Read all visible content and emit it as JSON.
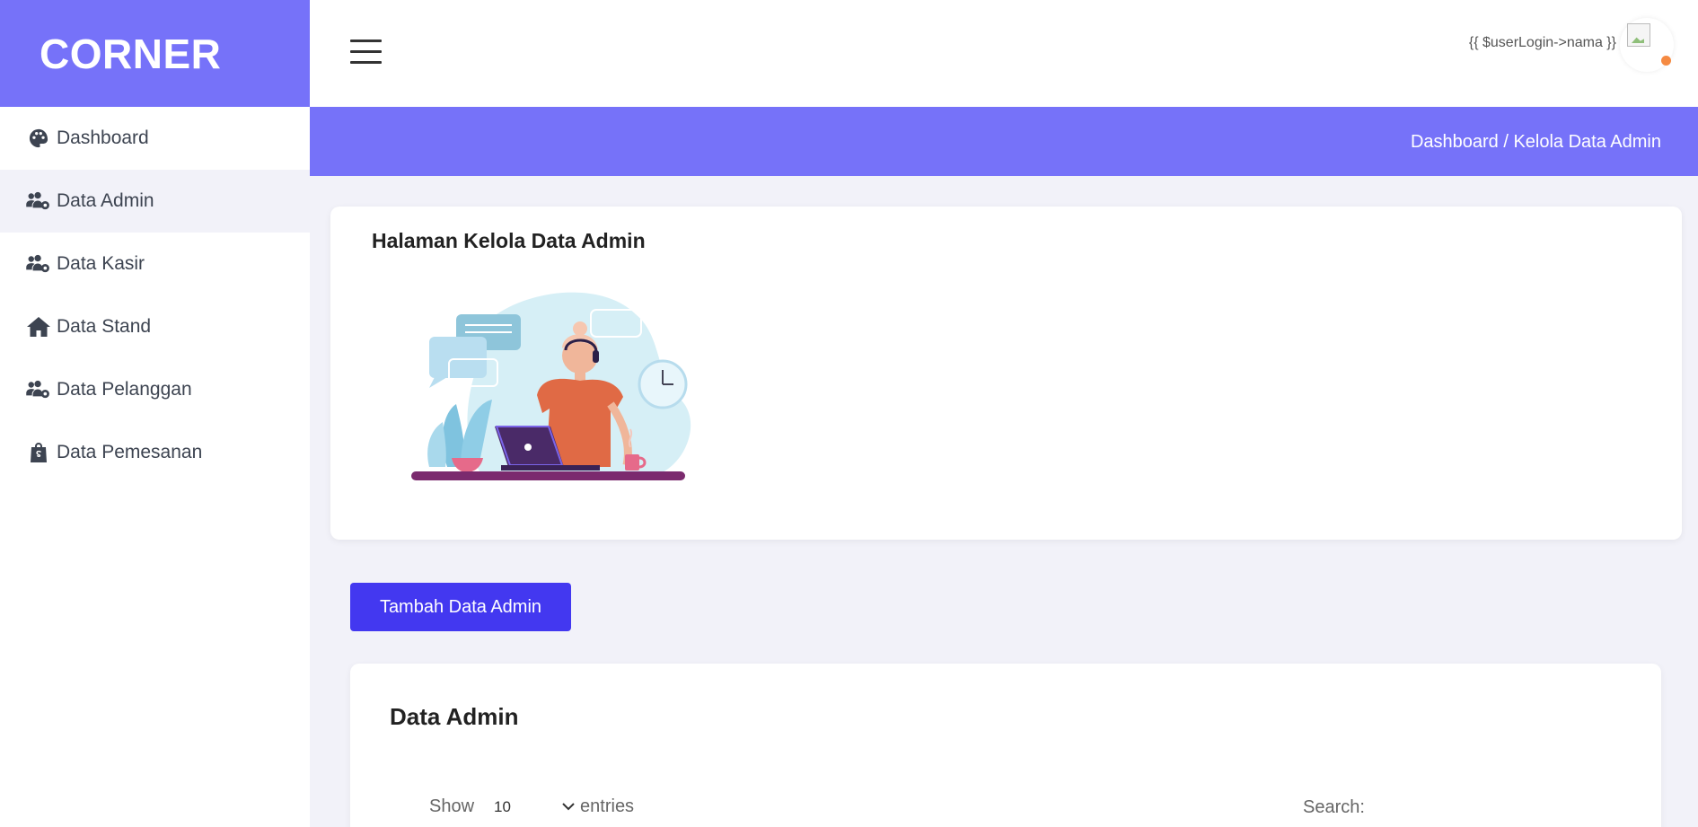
{
  "brand": "CORNER",
  "sidebar": {
    "items": [
      {
        "label": "Dashboard",
        "icon": "palette-icon",
        "active": false
      },
      {
        "label": "Data Admin",
        "icon": "users-gear-icon",
        "active": true
      },
      {
        "label": "Data Kasir",
        "icon": "users-gear-icon",
        "active": false
      },
      {
        "label": "Data Stand",
        "icon": "home-icon",
        "active": false
      },
      {
        "label": "Data Pelanggan",
        "icon": "users-gear-icon",
        "active": false
      },
      {
        "label": "Data Pemesanan",
        "icon": "shopping-bag-icon",
        "active": false
      }
    ]
  },
  "header": {
    "username": "{{ $userLogin->nama }}"
  },
  "breadcrumb": "Dashboard / Kelola Data Admin",
  "hero": {
    "title": "Halaman Kelola Data Admin"
  },
  "actions": {
    "add_label": "Tambah Data Admin"
  },
  "table": {
    "title": "Data Admin",
    "show_label": "Show",
    "entries_value": "10",
    "entries_label": "entries",
    "search_label": "Search:"
  },
  "colors": {
    "accent": "#7672f9",
    "button": "#4338f0"
  }
}
